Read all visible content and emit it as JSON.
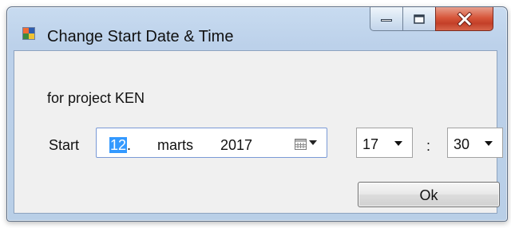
{
  "window": {
    "title": "Change Start Date & Time",
    "icons": {
      "app": "window-app-icon",
      "minimize": "minimize-icon",
      "maximize": "maximize-icon",
      "close": "close-icon"
    },
    "colors": {
      "frame": "#bcd1ea",
      "close_button": "#c94a32",
      "selection": "#3399ff",
      "client_background": "#f0f0f0"
    }
  },
  "form": {
    "project_text": "for project KEN",
    "start_label": "Start",
    "date": {
      "day": "12",
      "separator": ".",
      "month": "marts",
      "year": "2017",
      "calendar_icon": "calendar-icon",
      "dropdown_icon": "chevron-down-icon"
    },
    "time": {
      "hour": "17",
      "separator": ":",
      "minute": "30",
      "dropdown_icon": "chevron-down-icon"
    },
    "ok_label": "Ok"
  }
}
